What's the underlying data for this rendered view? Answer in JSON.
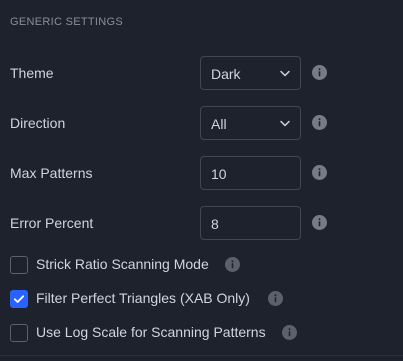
{
  "section": {
    "title": "GENERIC SETTINGS"
  },
  "theme": {
    "label": "Theme",
    "value": "Dark"
  },
  "direction": {
    "label": "Direction",
    "value": "All"
  },
  "max_patterns": {
    "label": "Max Patterns",
    "value": "10"
  },
  "error_percent": {
    "label": "Error Percent",
    "value": "8"
  },
  "checkboxes": [
    {
      "label": "Strick Ratio Scanning Mode",
      "checked": false
    },
    {
      "label": "Filter Perfect Triangles (XAB Only)",
      "checked": true
    },
    {
      "label": "Use Log Scale for Scanning Patterns",
      "checked": false
    }
  ],
  "colors": {
    "background": "#1e222d",
    "text": "#d1d4dc",
    "muted_text": "#8a8e99",
    "border": "#434651",
    "accent": "#2962ff",
    "info_icon": "#787b86"
  },
  "icons": {
    "info": "info-circle-icon",
    "dropdown": "chevron-down-icon",
    "check": "checkmark-icon"
  }
}
